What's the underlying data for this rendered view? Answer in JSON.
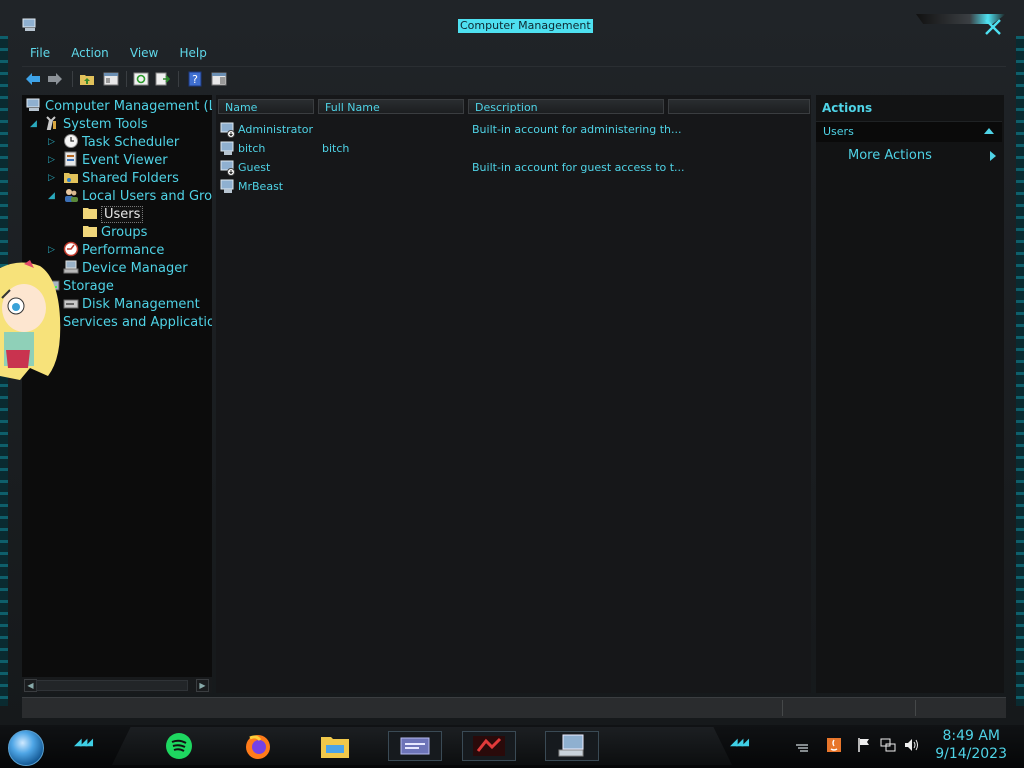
{
  "window": {
    "title": "Computer Management"
  },
  "menu": [
    "File",
    "Action",
    "View",
    "Help"
  ],
  "tree": {
    "root": "Computer Management (Loc",
    "system_tools": "System Tools",
    "task_scheduler": "Task Scheduler",
    "event_viewer": "Event Viewer",
    "shared_folders": "Shared Folders",
    "local_users": "Local Users and Grou",
    "users": "Users",
    "groups": "Groups",
    "performance": "Performance",
    "device_manager": "Device Manager",
    "storage": "Storage",
    "disk_management": "Disk Management",
    "services": "Services and Application:"
  },
  "list": {
    "columns": [
      "Name",
      "Full Name",
      "Description"
    ],
    "rows": [
      {
        "name": "Administrator",
        "full_name": "",
        "description": "Built-in account for administering th..."
      },
      {
        "name": "bitch",
        "full_name": "bitch",
        "description": ""
      },
      {
        "name": "Guest",
        "full_name": "",
        "description": "Built-in account for guest access to t..."
      },
      {
        "name": "MrBeast",
        "full_name": "",
        "description": ""
      }
    ]
  },
  "actions": {
    "title": "Actions",
    "section": "Users",
    "more": "More Actions"
  },
  "clock": {
    "time": "8:49 AM",
    "date": "9/14/2023"
  },
  "colors": {
    "accent": "#4fd3e6",
    "background": "#161719",
    "tree_background": "#0c0c0c"
  }
}
